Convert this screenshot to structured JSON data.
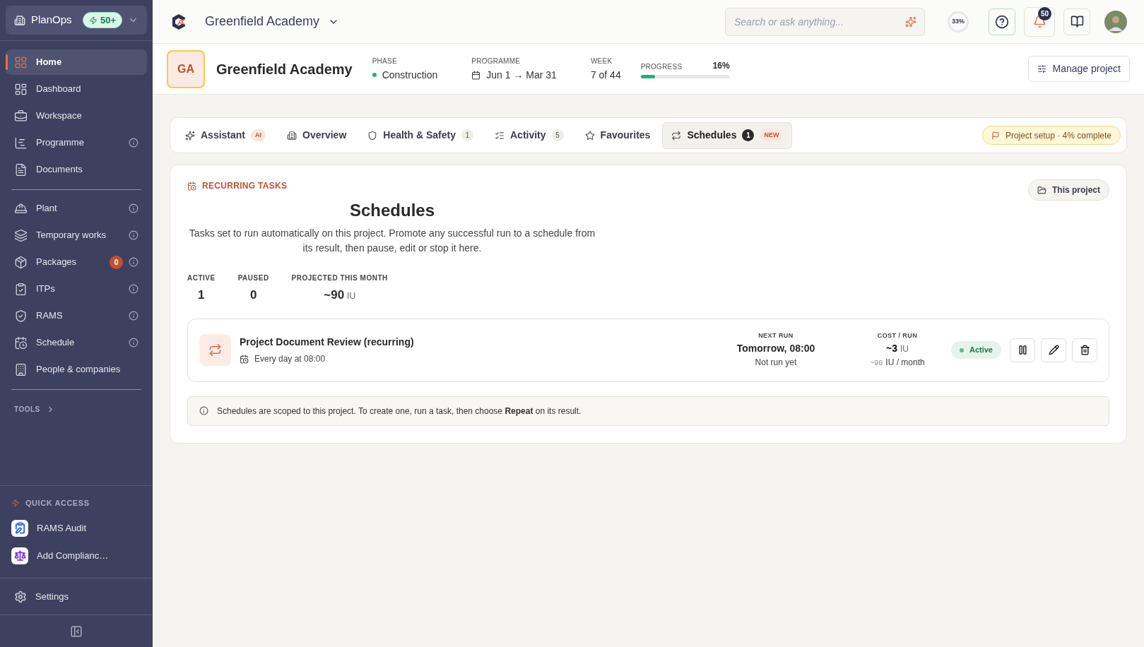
{
  "sidebar": {
    "workspace": "PlanOps",
    "credits": "50+",
    "groups": [
      [
        {
          "label": "Home",
          "selected": true,
          "info": false
        },
        {
          "label": "Dashboard",
          "selected": false,
          "info": false
        },
        {
          "label": "Workspace",
          "selected": false,
          "info": false
        },
        {
          "label": "Programme",
          "selected": false,
          "info": true
        },
        {
          "label": "Documents",
          "selected": false,
          "info": false
        }
      ],
      [
        {
          "label": "Plant",
          "selected": false,
          "info": true
        },
        {
          "label": "Temporary works",
          "selected": false,
          "info": true
        },
        {
          "label": "Packages",
          "selected": false,
          "info": true,
          "badge": "0"
        },
        {
          "label": "ITPs",
          "selected": false,
          "info": true
        },
        {
          "label": "RAMS",
          "selected": false,
          "info": true
        },
        {
          "label": "Schedule",
          "selected": false,
          "info": true
        },
        {
          "label": "People & companies",
          "selected": false,
          "info": false
        }
      ]
    ],
    "tools": "TOOLS",
    "quick_access": {
      "title": "QUICK ACCESS",
      "items": [
        {
          "label": "RAMS Audit",
          "color": "#2563eb"
        },
        {
          "label": "Add Complianc…",
          "color": "#7c3aed"
        }
      ]
    },
    "settings": "Settings"
  },
  "topbar": {
    "project": "Greenfield Academy",
    "search": {
      "placeholder": "Search or ask anything..."
    },
    "usage": "33%",
    "notifications": "50"
  },
  "project": {
    "initials": "GA",
    "name": "Greenfield Academy",
    "phase": {
      "label": "PHASE",
      "value": "Construction"
    },
    "programme": {
      "label": "PROGRAMME",
      "value": "Jun 1 → Mar 31"
    },
    "week": {
      "label": "WEEK",
      "value": "7 of 44"
    },
    "progress": {
      "label": "PROGRESS",
      "reading": "16%",
      "level": 0.16
    },
    "manage": "Manage project"
  },
  "tabs": [
    {
      "label": "Assistant",
      "selected": false,
      "tag": "AI"
    },
    {
      "label": "Overview",
      "selected": false
    },
    {
      "label": "Health & Safety",
      "selected": false,
      "count": "1"
    },
    {
      "label": "Activity",
      "selected": false,
      "count": "5"
    },
    {
      "label": "Favourites",
      "selected": false
    },
    {
      "label": "Schedules",
      "selected": true,
      "count": "1",
      "tag": "NEW"
    }
  ],
  "setup": "Project setup · 4% complete",
  "panel": {
    "eyebrow": "RECURRING TASKS",
    "title": "Schedules",
    "scope": "This project",
    "description": "Tasks set to run automatically on this project. Promote any successful run to a schedule from its result, then pause, edit or stop it here.",
    "stats": [
      {
        "label": "ACTIVE",
        "value": "1"
      },
      {
        "label": "PAUSED",
        "value": "0"
      },
      {
        "label": "PROJECTED THIS MONTH",
        "value": "~90",
        "unit": "IU"
      }
    ],
    "schedules": [
      {
        "name": "Project Document Review (recurring)",
        "cadence": "Every day at 08:00",
        "next_label": "NEXT RUN",
        "next": "Tomorrow, 08:00",
        "last": "Not run yet",
        "cost_label": "COST / RUN",
        "cost": "~3",
        "cost_unit": "IU",
        "monthly": "~90",
        "monthly_unit": "IU / month",
        "status": "Active",
        "active": true
      }
    ],
    "note": "Schedules are scoped to this project. To create one, run a task, then choose **Repeat** on its result."
  }
}
